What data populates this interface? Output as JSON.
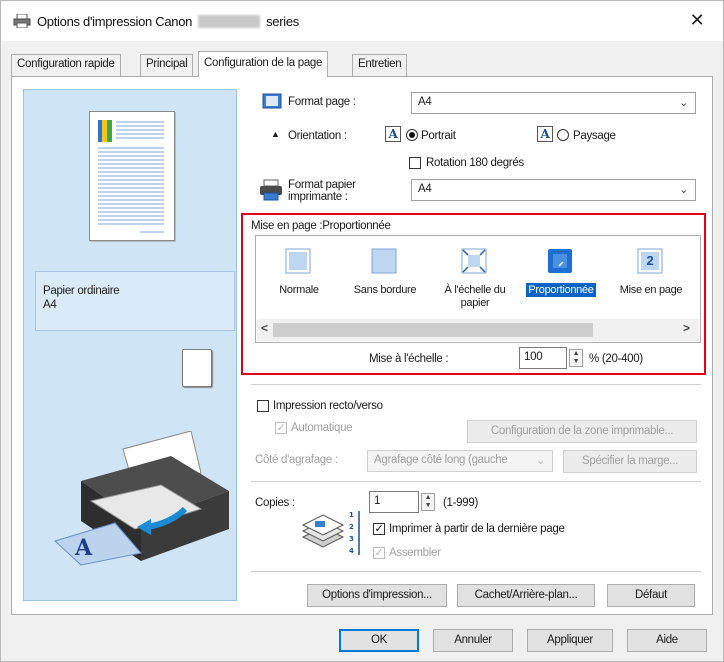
{
  "window": {
    "title_prefix": "Options d'impression Canon",
    "title_suffix": "series",
    "close_glyph": "✕"
  },
  "tabs": [
    {
      "label": "Configuration rapide"
    },
    {
      "label": "Principal"
    },
    {
      "label": "Configuration de la page",
      "active": true
    },
    {
      "label": "Entretien"
    }
  ],
  "preview": {
    "media_type": "Papier ordinaire",
    "media_size": "A4"
  },
  "page": {
    "format_label": "Format page :",
    "format_value": "A4",
    "orientation_label": "Orientation :",
    "orientation_options": [
      "Portrait",
      "Paysage"
    ],
    "orientation_selected": "Portrait",
    "orientation_glyph": "A",
    "rotate_label": "Rotation 180 degrés",
    "printer_paper_label_1": "Format papier",
    "printer_paper_label_2": "imprimante :",
    "printer_paper_value": "A4"
  },
  "layout": {
    "group_title": "Mise en page :Proportionnée",
    "items": [
      {
        "label_1": "Normale",
        "label_2": ""
      },
      {
        "label_1": "Sans bordure",
        "label_2": ""
      },
      {
        "label_1": "À l'échelle du",
        "label_2": "papier"
      },
      {
        "label_1": "Proportionnée",
        "label_2": "",
        "selected": true
      },
      {
        "label_1": "Mise en page",
        "label_2": ""
      }
    ],
    "item5_glyph": "2",
    "scroll_left": "<",
    "scroll_right": ">",
    "scale_label": "Mise à l'échelle :",
    "scale_value": "100",
    "scale_range": "% (20-400)"
  },
  "duplex": {
    "label": "Impression recto/verso",
    "auto_label": "Automatique",
    "print_area_button": "Configuration de la zone imprimable...",
    "binding_label": "Côté d'agrafage :",
    "binding_value": "Agrafage côté long (gauche",
    "margin_button": "Spécifier la marge..."
  },
  "copies": {
    "label": "Copies :",
    "value": "1",
    "range": "(1-999)",
    "reverse_label": "Imprimer à partir de la dernière page",
    "collate_label": "Assembler"
  },
  "bottom_buttons": {
    "print_options": "Options d'impression...",
    "stamp": "Cachet/Arrière-plan...",
    "defaults": "Défaut"
  },
  "dialog_buttons": {
    "ok": "OK",
    "cancel": "Annuler",
    "apply": "Appliquer",
    "help": "Aide"
  },
  "colors": {
    "accent_red": "#e2001a",
    "selection_blue": "#0a64c8",
    "preview_bg": "#cfe5f6"
  }
}
